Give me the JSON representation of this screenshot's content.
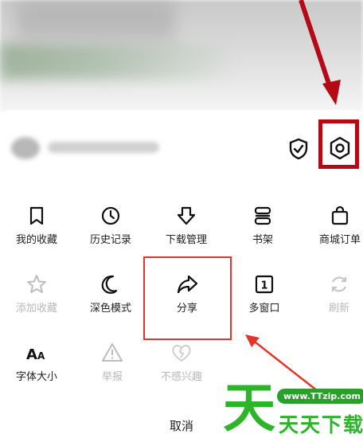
{
  "menu": {
    "row1": [
      {
        "label": "我的收藏",
        "icon": "bookmark-icon"
      },
      {
        "label": "历史记录",
        "icon": "clock-icon"
      },
      {
        "label": "下载管理",
        "icon": "download-icon"
      },
      {
        "label": "书架",
        "icon": "bookshelf-icon"
      },
      {
        "label": "商城订单",
        "icon": "shopping-bag-icon"
      }
    ],
    "row2": [
      {
        "label": "添加收藏",
        "icon": "star-icon",
        "disabled": true
      },
      {
        "label": "深色模式",
        "icon": "moon-icon"
      },
      {
        "label": "分享",
        "icon": "share-icon"
      },
      {
        "label": "多窗口",
        "icon": "window-count-icon",
        "badge": "1"
      },
      {
        "label": "刷新",
        "icon": "refresh-icon",
        "disabled": true
      }
    ],
    "row3": [
      {
        "label": "字体大小",
        "icon": "font-size-icon",
        "glyph": "AA"
      },
      {
        "label": "举报",
        "icon": "warning-icon",
        "disabled": true
      },
      {
        "label": "不感兴趣",
        "icon": "broken-heart-icon",
        "disabled": true
      }
    ]
  },
  "header": {
    "shield_icon": "shield-check-icon",
    "settings_icon": "settings-icon"
  },
  "cancel_label": "取消",
  "watermark": {
    "big": "天",
    "url": "www.TTzip.com",
    "text": "天天下载"
  },
  "colors": {
    "highlight_dark": "#b50a16",
    "highlight_red": "#e8332b",
    "watermark_green": "#2db52a"
  }
}
